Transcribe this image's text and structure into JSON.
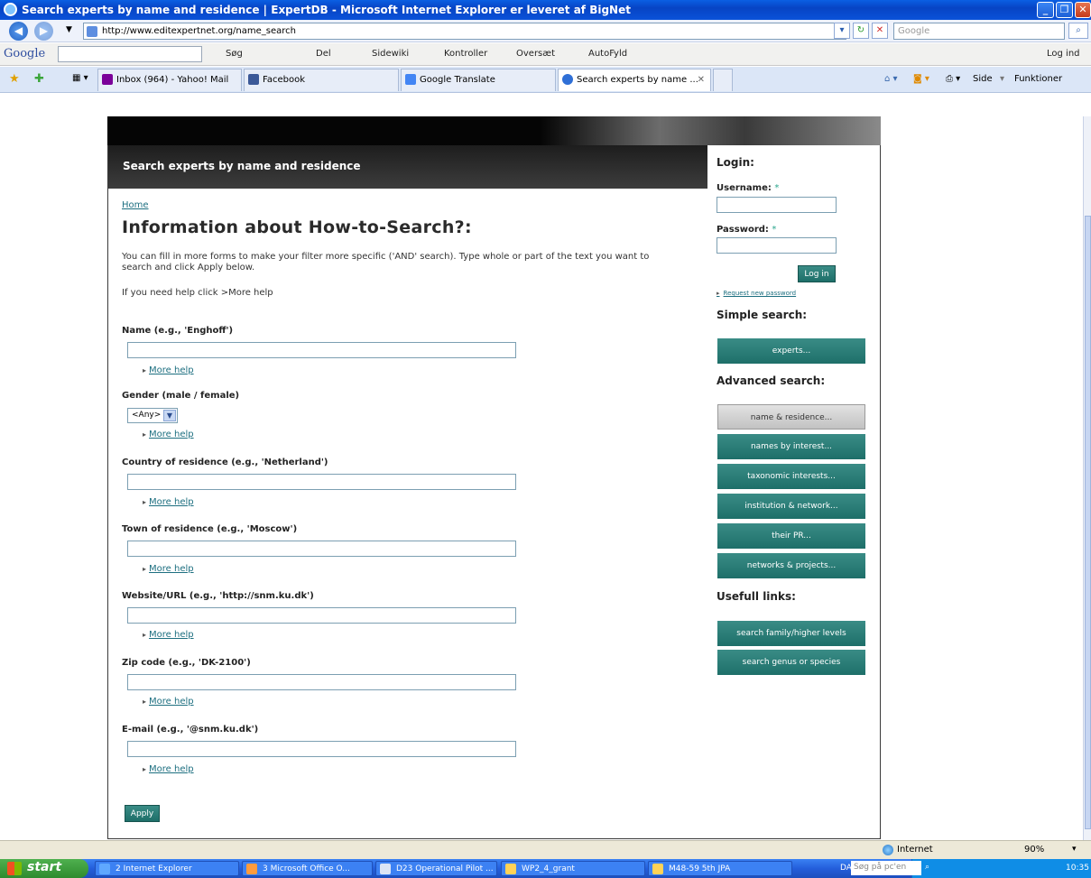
{
  "window": {
    "title": "Search experts by name and residence | ExpertDB - Microsoft Internet Explorer er leveret af BigNet"
  },
  "addressbar": {
    "url": "http://www.editexpertnet.org/name_search",
    "search_placeholder": "Google"
  },
  "google_toolbar": {
    "logo": "Google",
    "items": [
      "Søg",
      "Del",
      "Sidewiki",
      "Kontroller",
      "Oversæt",
      "AutoFyld"
    ],
    "login": "Log ind"
  },
  "tabs": [
    {
      "label": "Inbox (964) - Yahoo! Mail",
      "color": "#7b0099"
    },
    {
      "label": "Facebook",
      "color": "#3b5998"
    },
    {
      "label": "Google Translate",
      "color": "#4285f4"
    },
    {
      "label": "Search experts by name ...",
      "color": "#2f6fd6",
      "active": true
    }
  ],
  "command_bar": {
    "page": "Side",
    "tools": "Funktioner"
  },
  "page": {
    "header_title": "Search experts by name and residence",
    "breadcrumb": "Home",
    "heading": "Information about How-to-Search?:",
    "intro": "You can fill in more forms to make your filter more specific ('AND' search). Type whole or part of the text you want to search and click Apply below.",
    "help_line": "If you need help click >More help",
    "fields": [
      {
        "label": "Name (e.g., 'Enghoff')",
        "help": "More help"
      },
      {
        "label": "Gender (male / female)",
        "help": "More help",
        "select_value": "<Any>"
      },
      {
        "label": "Country of residence (e.g., 'Netherland')",
        "help": "More help"
      },
      {
        "label": "Town of residence (e.g., 'Moscow')",
        "help": "More help"
      },
      {
        "label": "Website/URL (e.g., 'http://snm.ku.dk')",
        "help": "More help"
      },
      {
        "label": "Zip code (e.g., 'DK-2100')",
        "help": "More help"
      },
      {
        "label": "E-mail (e.g., '@snm.ku.dk')",
        "help": "More help"
      }
    ],
    "apply_label": "Apply"
  },
  "sidebar": {
    "login_title": "Login:",
    "username_label": "Username:",
    "password_label": "Password:",
    "required_mark": "*",
    "login_button": "Log in",
    "request_password": "Request new password",
    "simple_search_title": "Simple search:",
    "simple_buttons": [
      "experts..."
    ],
    "advanced_search_title": "Advanced search:",
    "advanced_buttons": [
      "name & residence...",
      "names by interest...",
      "taxonomic interests...",
      "institution & network...",
      "their PR...",
      "networks & projects..."
    ],
    "useful_links_title": "Usefull links:",
    "useful_buttons": [
      "search family/higher levels",
      "search genus or species"
    ]
  },
  "statusbar": {
    "zone": "Internet",
    "zoom": "90%"
  },
  "taskbar": {
    "start": "start",
    "tasks": [
      "2 Internet Explorer",
      "3 Microsoft Office O...",
      "D23 Operational Pilot ...",
      "WP2_4_grant",
      "M48-59 5th JPA"
    ],
    "lang": "DA",
    "search_placeholder": "Søg på pc'en",
    "clock": "10:35"
  }
}
